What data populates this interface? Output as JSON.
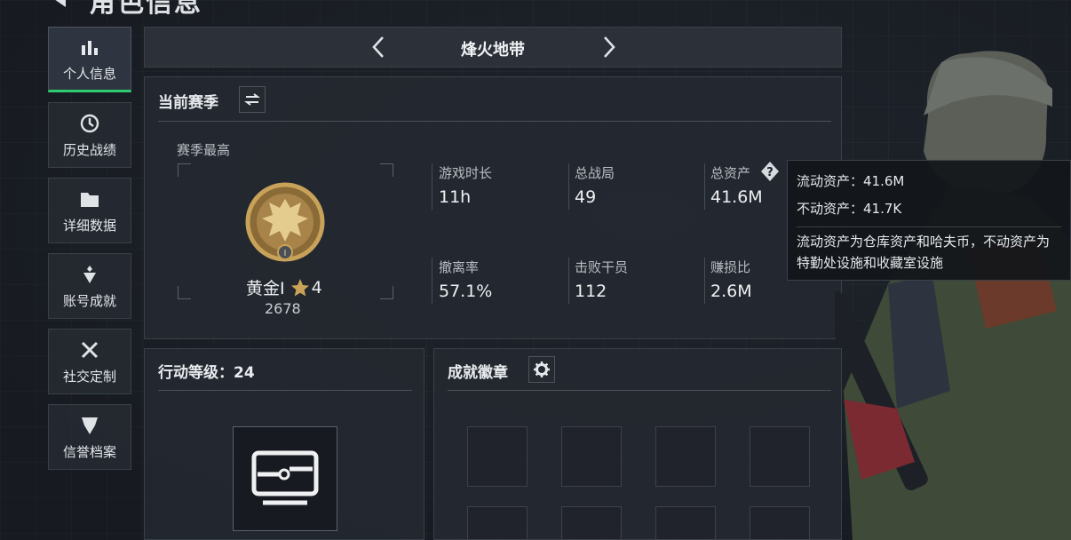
{
  "header": {
    "title": "角色信息"
  },
  "sidebar": {
    "items": [
      {
        "label": "个人信息",
        "icon": "bar-chart-icon",
        "active": true
      },
      {
        "label": "历史战绩",
        "icon": "history-clock-icon",
        "active": false
      },
      {
        "label": "详细数据",
        "icon": "folder-icon",
        "active": false
      },
      {
        "label": "账号成就",
        "icon": "achievement-icon",
        "active": false
      },
      {
        "label": "社交定制",
        "icon": "tools-icon",
        "active": false
      },
      {
        "label": "信誉档案",
        "icon": "shield-emblem-icon",
        "active": false
      }
    ]
  },
  "mode": {
    "title": "烽火地带"
  },
  "season": {
    "title": "当前赛季",
    "peak_label": "赛季最高",
    "rank_name": "黄金I",
    "rank_stars": "4",
    "rank_points": "2678",
    "stats": [
      {
        "label": "游戏时长",
        "value": "11h"
      },
      {
        "label": "总战局",
        "value": "49"
      },
      {
        "label": "总资产",
        "value": "41.6M"
      },
      {
        "label": "撤离率",
        "value": "57.1%"
      },
      {
        "label": "击败干员",
        "value": "112"
      },
      {
        "label": "赚损比",
        "value": "2.6M"
      }
    ]
  },
  "tooltip": {
    "liquid": "流动资产：41.6M",
    "fixed": "不动资产：41.7K",
    "description": "流动资产为仓库资产和哈夫币，不动资产为特勤处设施和收藏室设施"
  },
  "action_level": {
    "title": "行动等级：24"
  },
  "badges": {
    "title": "成就徽章"
  },
  "colors": {
    "accent": "#2ecc71",
    "gold": "#c9a25a"
  }
}
